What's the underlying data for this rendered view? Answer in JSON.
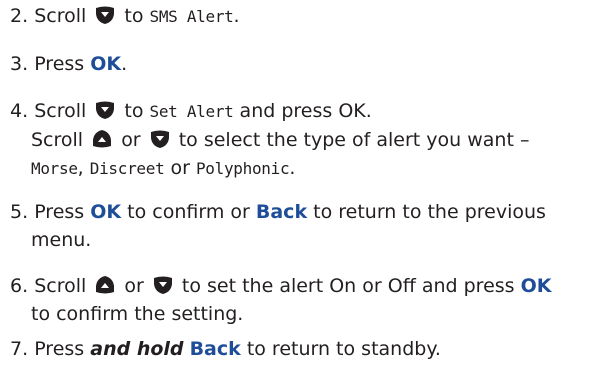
{
  "steps": [
    {
      "num": "2.",
      "t1": "Scroll",
      "t2": "to",
      "menu": "SMS Alert",
      "t3": "."
    },
    {
      "num": "3.",
      "t1": "Press",
      "key": "OK",
      "t2": "."
    },
    {
      "num": "4.",
      "t1": "Scroll",
      "t2": "to",
      "menu": "Set Alert",
      "t3": "and press OK.",
      "l2_t1": "Scroll",
      "l2_t2": "or",
      "l2_t3": "to select the type of alert you want –",
      "opt1": "Morse",
      "sep1": ",",
      "opt2": "Discreet",
      "sep2": "or",
      "opt3": "Polyphonic",
      "end": "."
    },
    {
      "num": "5.",
      "t1": "Press",
      "key1": "OK",
      "t2": "to confirm or",
      "key2": "Back",
      "t3": "to return to the previous",
      "l2": "menu."
    },
    {
      "num": "6.",
      "t1": "Scroll",
      "t2": "or",
      "t3": "to set the alert On or Off and press",
      "key": "OK",
      "l2": "to confirm the setting."
    },
    {
      "num": "7.",
      "t1": "Press",
      "emph": "and hold",
      "key": "Back",
      "t2": "to return to standby."
    }
  ],
  "icons": {
    "down": "scroll-down-key-icon",
    "up": "scroll-up-key-icon"
  },
  "colors": {
    "key": "#1f4e99",
    "text": "#231f20"
  }
}
